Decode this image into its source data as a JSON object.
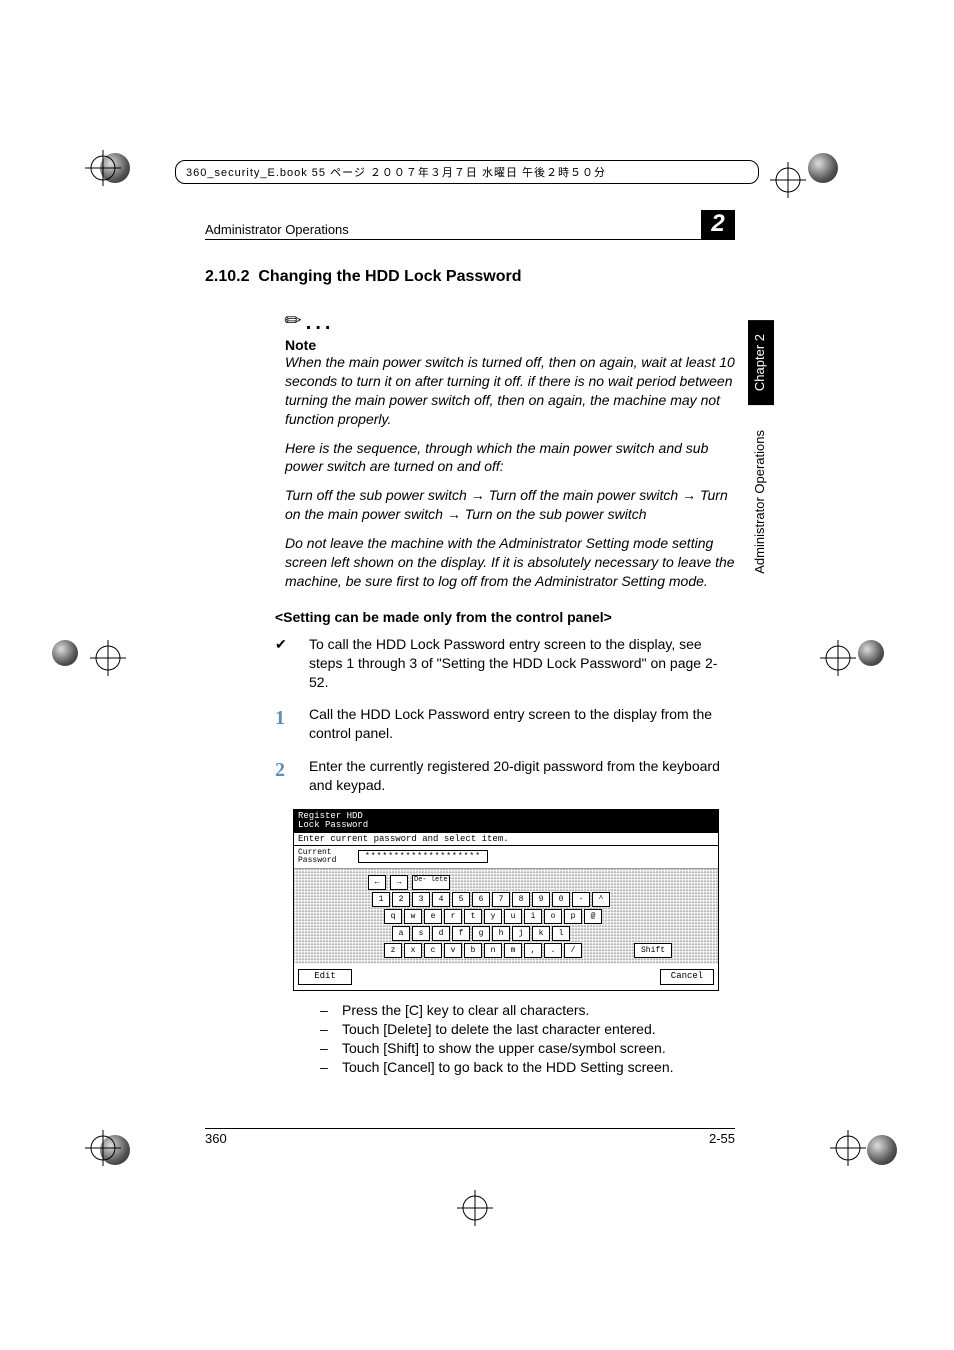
{
  "header_meta": "360_security_E.book 55 ページ ２００７年３月７日 水曜日 午後２時５０分",
  "running_head": "Administrator Operations",
  "chapter_badge": "2",
  "section_number": "2.10.2",
  "section_title": "Changing the HDD Lock Password",
  "note_label": "Note",
  "note_paragraphs": {
    "p1": "When the main power switch is turned off, then on again, wait at least 10 seconds to turn it on after turning it off. if there is no wait period between turning the main power switch off, then on again, the machine may not function properly.",
    "p2": "Here is the sequence, through which the main power switch and sub power switch are turned on and off:",
    "p3a": "Turn off the sub power switch ",
    "p3b": " Turn off the main power switch ",
    "p3c": " Turn on the main power switch ",
    "p3d": " Turn on the sub power switch",
    "p4": "Do not leave the machine with the Administrator Setting mode setting screen left shown on the display. If it is absolutely necessary to leave the machine, be sure first to log off from the Administrator Setting mode."
  },
  "subhead": "<Setting can be made only from the control panel>",
  "steps": {
    "check": "To call the HDD Lock Password entry screen to the display, see steps 1 through 3 of \"Setting the HDD Lock Password\" on page 2-52.",
    "s1": "Call the HDD Lock Password entry screen to the display from the control panel.",
    "s2": "Enter the currently registered 20-digit password from the keyboard and keypad."
  },
  "screenshot": {
    "title_line1": "Register HDD",
    "title_line2": "Lock Password",
    "instr": "Enter current password and select item.",
    "field_label_line1": "Current",
    "field_label_line2": "Password",
    "field_value": "********************",
    "nav": {
      "left": "←",
      "right": "→",
      "delete": "De-\nlete"
    },
    "row1": [
      "1",
      "2",
      "3",
      "4",
      "5",
      "6",
      "7",
      "8",
      "9",
      "0",
      "-",
      "^"
    ],
    "row2": [
      "q",
      "w",
      "e",
      "r",
      "t",
      "y",
      "u",
      "i",
      "o",
      "p",
      "@"
    ],
    "row3": [
      "a",
      "s",
      "d",
      "f",
      "g",
      "h",
      "j",
      "k",
      "l"
    ],
    "row4": [
      "z",
      "x",
      "c",
      "v",
      "b",
      "n",
      "m",
      ",",
      ".",
      "/"
    ],
    "shift": "Shift",
    "edit": "Edit",
    "cancel": "Cancel"
  },
  "bullets": {
    "b1": "Press the [C] key to clear all characters.",
    "b2": "Touch [Delete] to delete the last character entered.",
    "b3": "Touch [Shift] to show the upper case/symbol screen.",
    "b4": "Touch [Cancel] to go back to the HDD Setting screen."
  },
  "side_tab_black": "Chapter 2",
  "side_tab_white": "Administrator Operations",
  "footer_left": "360",
  "footer_right": "2-55"
}
